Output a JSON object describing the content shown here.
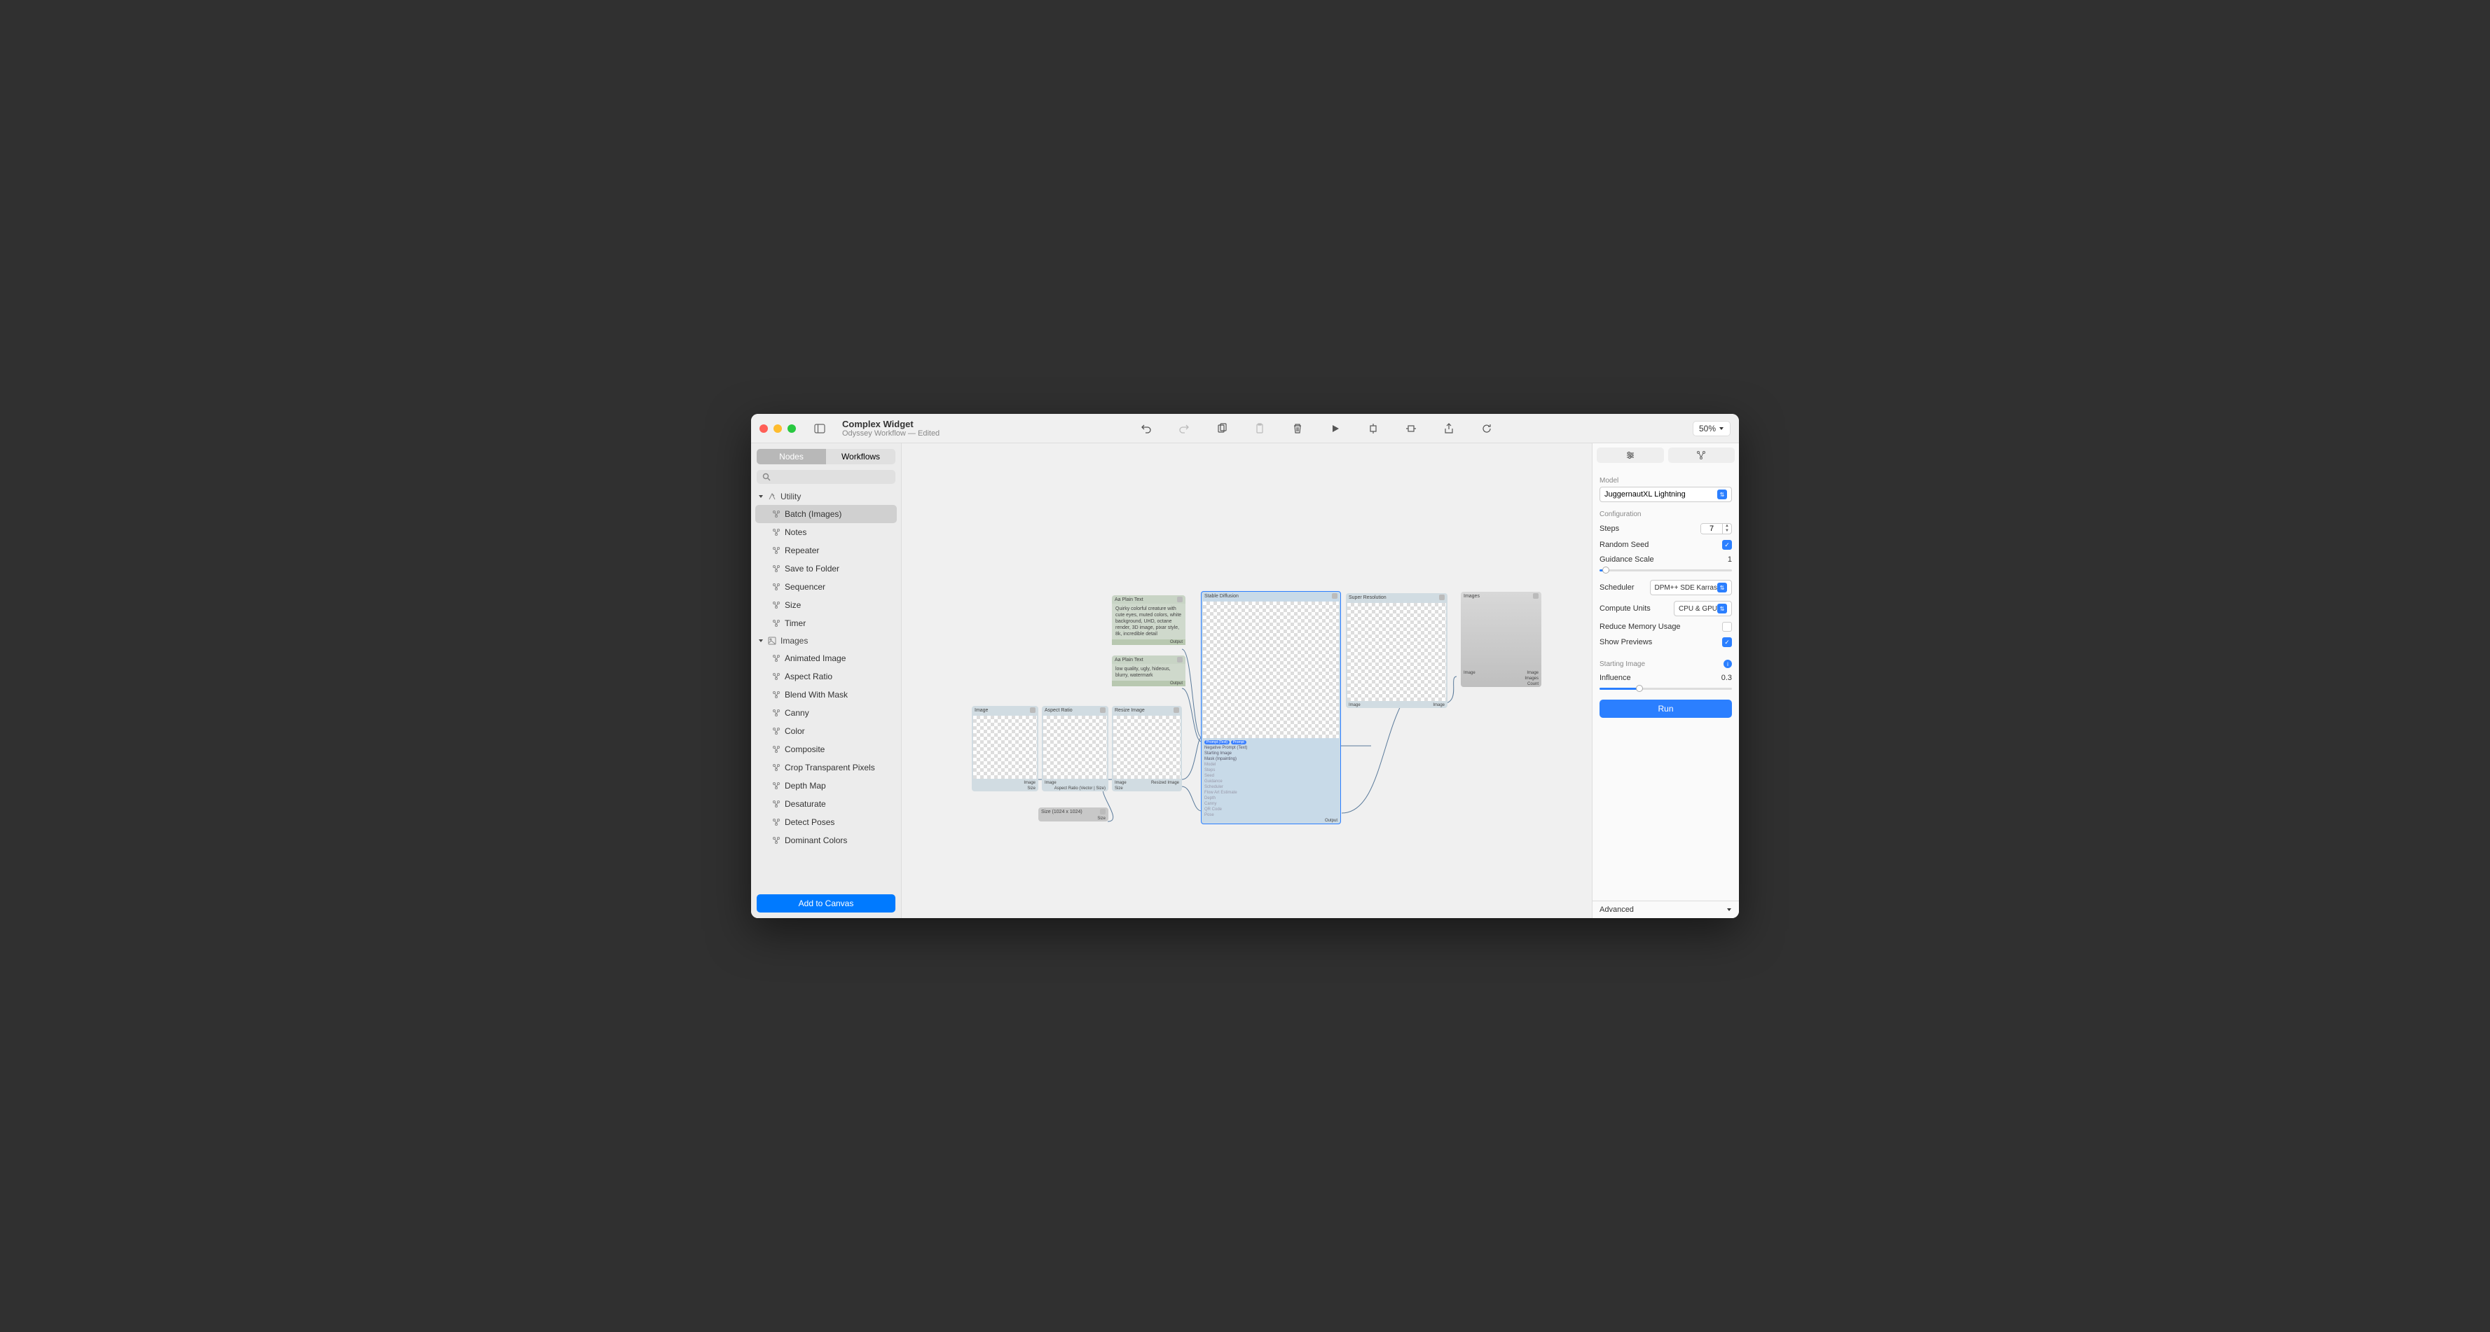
{
  "title": {
    "main": "Complex Widget",
    "sub": "Odyssey Workflow — Edited"
  },
  "zoom": "50%",
  "sidebar": {
    "tabs": [
      "Nodes",
      "Workflows"
    ],
    "active_tab": 0,
    "groups": [
      {
        "name": "Utility",
        "items": [
          "Batch (Images)",
          "Notes",
          "Repeater",
          "Save to Folder",
          "Sequencer",
          "Size",
          "Timer"
        ],
        "selected": 0
      },
      {
        "name": "Images",
        "items": [
          "Animated Image",
          "Aspect Ratio",
          "Blend With Mask",
          "Canny",
          "Color",
          "Composite",
          "Crop Transparent Pixels",
          "Depth Map",
          "Desaturate",
          "Detect Poses",
          "Dominant Colors"
        ],
        "selected": -1
      }
    ],
    "add_button": "Add to Canvas"
  },
  "canvas_nodes": {
    "image": {
      "title": "Image",
      "out": "Image",
      "size": "Size"
    },
    "aspect": {
      "title": "Aspect Ratio",
      "in": "Image",
      "out": "Aspect Ratio (Vector | Size)"
    },
    "resize": {
      "title": "Resize Image",
      "in": "Image",
      "out": "Resized Image",
      "size": "Size"
    },
    "size": {
      "title": "Size (1024 x 1024)",
      "out": "Size"
    },
    "prompt1": {
      "title": "Aa Plain Text",
      "body": "Quirky colorful creature with cute eyes, muted colors, white background, UHD, octane render, 3D image, pixar style, 8k, incredible detail",
      "out": "Output"
    },
    "prompt2": {
      "title": "Aa Plain Text",
      "body": "low quality, ugly, hideous, blurry, watermark",
      "out": "Output"
    },
    "sd": {
      "title": "Stable Diffusion",
      "ports": [
        "Prompt (Text)",
        "Negative Prompt (Text)",
        "Starting Image",
        "Mask (Inpainting)"
      ],
      "badge": "Prompt",
      "out": "Output"
    },
    "super": {
      "title": "Super Resolution",
      "in": "Image",
      "out": "Image"
    },
    "images": {
      "title": "Images",
      "f1": "Image",
      "f2": "Images",
      "f3": "Count"
    }
  },
  "inspector": {
    "model_label": "Model",
    "model": "JuggernautXL Lightning",
    "config_label": "Configuration",
    "steps_label": "Steps",
    "steps": "7",
    "seed_label": "Random Seed",
    "seed_checked": true,
    "guidance_label": "Guidance Scale",
    "guidance": "1",
    "scheduler_label": "Scheduler",
    "scheduler": "DPM++ SDE Karras",
    "compute_label": "Compute Units",
    "compute": "CPU & GPU",
    "reduce_label": "Reduce Memory Usage",
    "reduce_checked": false,
    "preview_label": "Show Previews",
    "preview_checked": true,
    "starting_label": "Starting Image",
    "influence_label": "Influence",
    "influence": "0.3",
    "run": "Run",
    "advanced": "Advanced"
  }
}
